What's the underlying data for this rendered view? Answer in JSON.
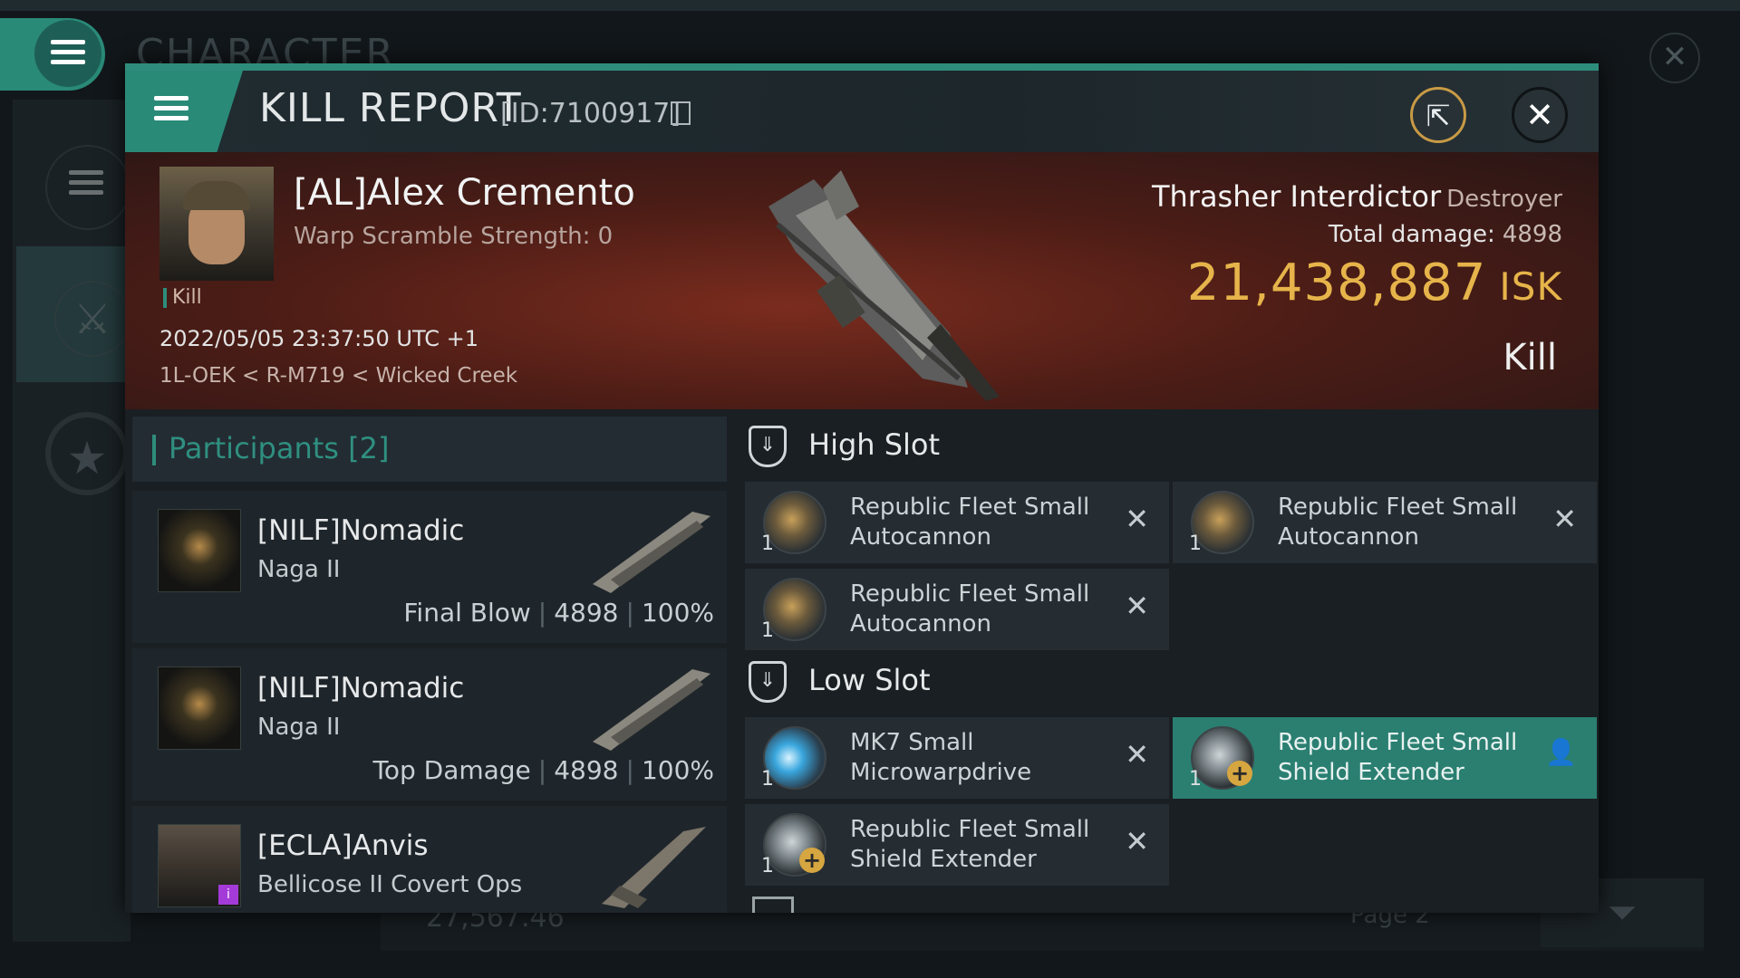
{
  "background": {
    "title": "CHARACTER",
    "close_glyph": "✕",
    "isk_partial": "27,567.46",
    "page_partial": "Page 2"
  },
  "header": {
    "title": "KILL REPORT",
    "id_text": "[ID:7100917]",
    "open_icon": "external-link-icon",
    "close_icon": "close-icon"
  },
  "victim": {
    "name": "[AL]Alex Cremento",
    "scram": "Warp Scramble Strength: 0",
    "tag": "Kill",
    "datetime": "2022/05/05 23:37:50 UTC +1",
    "location": "1L-OEK < R-M719 < Wicked Creek",
    "ship_name": "Thrasher Interdictor",
    "ship_class": "Destroyer",
    "damage_label": "Total damage:",
    "damage_value": "4898",
    "isk_value": "21,438,887",
    "isk_unit": "ISK",
    "result": "Kill"
  },
  "participants": {
    "title": "Participants [2]",
    "rows": [
      {
        "name": "[NILF]Nomadic",
        "ship": "Naga II",
        "role": "Final Blow",
        "damage": "4898",
        "percent": "100%"
      },
      {
        "name": "[NILF]Nomadic",
        "ship": "Naga II",
        "role": "Top Damage",
        "damage": "4898",
        "percent": "100%"
      },
      {
        "name": "[ECLA]Anvis",
        "ship": "Bellicose II Covert Ops",
        "badge": "i"
      }
    ]
  },
  "slots": {
    "high": {
      "title": "High Slot",
      "modules": [
        {
          "name": "Republic Fleet Small Autocannon",
          "qty": "1",
          "state": "✕"
        },
        {
          "name": "Republic Fleet Small Autocannon",
          "qty": "1",
          "state": "✕"
        },
        {
          "name": "Republic Fleet Small Autocannon",
          "qty": "1",
          "state": "✕"
        }
      ]
    },
    "low": {
      "title": "Low Slot",
      "modules": [
        {
          "name": "MK7 Small Microwarpdrive",
          "qty": "1",
          "state": "✕"
        },
        {
          "name": "Republic Fleet Small Shield Extender",
          "qty": "1",
          "state": "👤",
          "plus": "+"
        },
        {
          "name": "Republic Fleet Small Shield Extender",
          "qty": "1",
          "state": "✕",
          "plus": "+"
        }
      ]
    }
  },
  "colors": {
    "accent": "#2e8c7b",
    "isk": "#e6b44a",
    "selected_row": "#2a7f71"
  }
}
